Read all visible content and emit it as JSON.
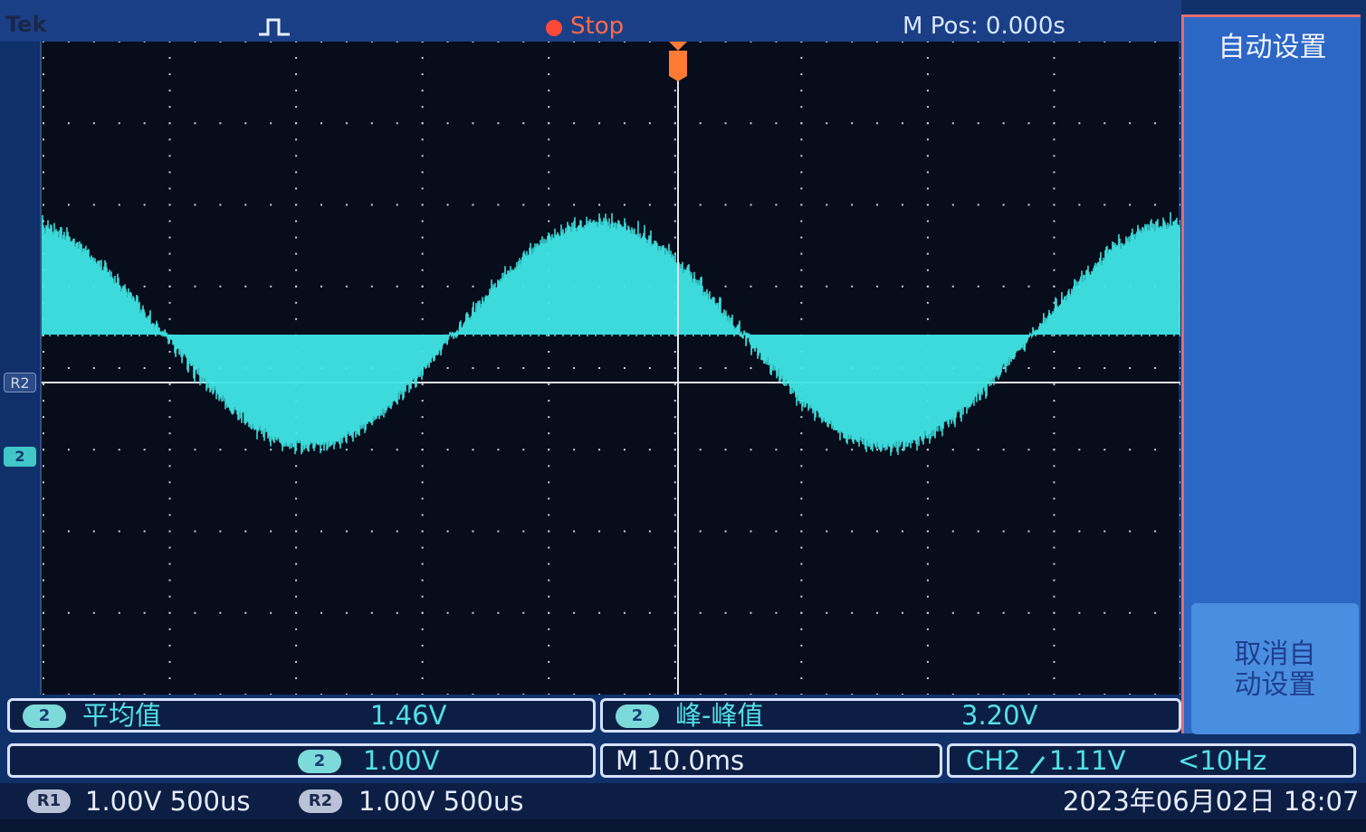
{
  "topbar": {
    "brand": "Tek",
    "run_state": "Stop",
    "horizontal_position": "M Pos: 0.000s",
    "trigger_icon": "pulse-trigger-icon",
    "run_indicator_color": "#ff4a3a"
  },
  "side_menu": {
    "auto_setup": "自动设置",
    "cancel_auto_setup": "取消自\n动设置"
  },
  "markers": {
    "reference": "R2",
    "channel": "2"
  },
  "measurements": [
    {
      "channel": "2",
      "label": "平均值",
      "value": "1.46V"
    },
    {
      "channel": "2",
      "label": "峰-峰值",
      "value": "3.20V"
    }
  ],
  "status": {
    "channel": "2",
    "vertical_scale": "1.00V",
    "timebase": "M 10.0ms",
    "trigger_source": "CH2",
    "trigger_slope_icon": "rising-edge-icon",
    "trigger_level": "1.11V",
    "trigger_frequency": "<10Hz"
  },
  "references": [
    {
      "name": "R1",
      "setting": "1.00V 500us"
    },
    {
      "name": "R2",
      "setting": "1.00V 500us"
    }
  ],
  "datetime": "2023年06月02日 18:07",
  "colors": {
    "trace": "#3fe6e6",
    "reference_line": "#e0e4ea",
    "grid_dots": "#c7cfdc",
    "trigger_marker": "#ff7a33"
  }
}
